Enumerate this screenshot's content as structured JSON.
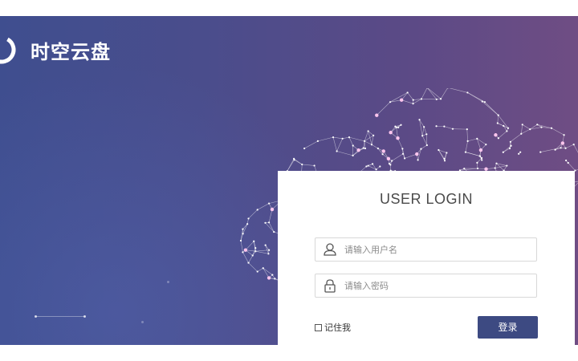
{
  "app": {
    "logo_text": "时空云盘"
  },
  "login": {
    "title": "USER LOGIN",
    "username_placeholder": "请输入用户名",
    "username_value": "",
    "password_placeholder": "请输入密码",
    "password_value": "",
    "remember_label": "记住我",
    "remember_checked": false,
    "submit_label": "登录"
  },
  "icons": {
    "logo": "ring-logo-icon",
    "username": "user-icon",
    "password": "lock-icon",
    "art": "network-cloud-illustration"
  },
  "colors": {
    "background_left": "#3f4e8f",
    "background_right": "#6f4d84",
    "button": "#3d4a82",
    "card": "#ffffff"
  }
}
